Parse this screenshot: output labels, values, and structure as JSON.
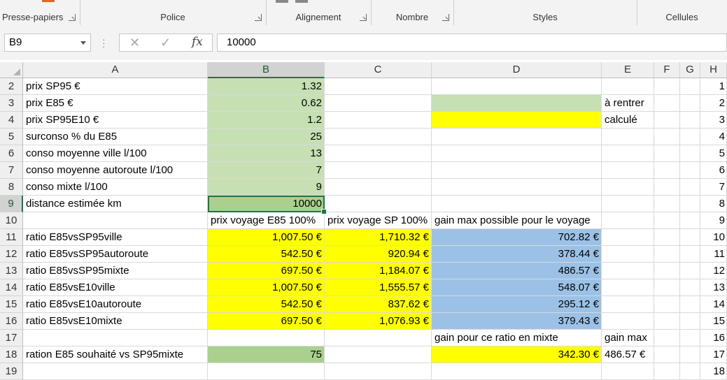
{
  "ribbon": {
    "groups": [
      {
        "label": "Presse-papiers"
      },
      {
        "label": "Police"
      },
      {
        "label": "Alignement"
      },
      {
        "label": "Nombre"
      },
      {
        "label": "Styles"
      },
      {
        "label": "Cellules"
      }
    ]
  },
  "formula_bar": {
    "name_box": "B9",
    "cancel_icon": "✕",
    "enter_icon": "✓",
    "fx_label": "fx",
    "content": "10000"
  },
  "columns": [
    "A",
    "B",
    "C",
    "D",
    "E",
    "F",
    "G",
    "H"
  ],
  "selected_column": "B",
  "selected_row": "9",
  "rows": [
    {
      "n": "2",
      "A": "prix SP95 €",
      "B": "1.32",
      "C": "",
      "D": "",
      "E": "",
      "F": "",
      "G": "",
      "H": "1"
    },
    {
      "n": "3",
      "A": "prix E85 €",
      "B": "0.62",
      "C": "",
      "D": "",
      "E": "à rentrer",
      "F": "",
      "G": "",
      "H": "2"
    },
    {
      "n": "4",
      "A": "prix SP95E10 €",
      "B": "1.2",
      "C": "",
      "D": "",
      "E": "calculé",
      "F": "",
      "G": "",
      "H": "3"
    },
    {
      "n": "5",
      "A": "surconso % du E85",
      "B": "25",
      "C": "",
      "D": "",
      "E": "",
      "F": "",
      "G": "",
      "H": "4"
    },
    {
      "n": "6",
      "A": "conso moyenne ville l/100",
      "B": "13",
      "C": "",
      "D": "",
      "E": "",
      "F": "",
      "G": "",
      "H": "5"
    },
    {
      "n": "7",
      "A": "conso moyenne autoroute l/100",
      "B": "7",
      "C": "",
      "D": "",
      "E": "",
      "F": "",
      "G": "",
      "H": "6"
    },
    {
      "n": "8",
      "A": "conso mixte l/100",
      "B": "9",
      "C": "",
      "D": "",
      "E": "",
      "F": "",
      "G": "",
      "H": "7"
    },
    {
      "n": "9",
      "A": "distance estimée km",
      "B": "10000",
      "C": "",
      "D": "",
      "E": "",
      "F": "",
      "G": "",
      "H": "8"
    },
    {
      "n": "10",
      "A": "",
      "B": "prix voyage E85 100%",
      "C": "prix voyage SP 100%",
      "D": "gain max possible pour le voyage",
      "E": "",
      "F": "",
      "G": "",
      "H": "9"
    },
    {
      "n": "11",
      "A": "ratio E85vsSP95ville",
      "B": "1,007.50 €",
      "C": "1,710.32 €",
      "D": "702.82 €",
      "E": "",
      "F": "",
      "G": "",
      "H": "10"
    },
    {
      "n": "12",
      "A": "ratio E85vsSP95autoroute",
      "B": "542.50 €",
      "C": "920.94 €",
      "D": "378.44 €",
      "E": "",
      "F": "",
      "G": "",
      "H": "11"
    },
    {
      "n": "13",
      "A": "ratio E85vsSP95mixte",
      "B": "697.50 €",
      "C": "1,184.07 €",
      "D": "486.57 €",
      "E": "",
      "F": "",
      "G": "",
      "H": "12"
    },
    {
      "n": "14",
      "A": "ratio E85vsE10ville",
      "B": "1,007.50 €",
      "C": "1,555.57 €",
      "D": "548.07 €",
      "E": "",
      "F": "",
      "G": "",
      "H": "13"
    },
    {
      "n": "15",
      "A": "ratio E85vsE10autoroute",
      "B": "542.50 €",
      "C": "837.62 €",
      "D": "295.12 €",
      "E": "",
      "F": "",
      "G": "",
      "H": "14"
    },
    {
      "n": "16",
      "A": "ratio E85vsE10mixte",
      "B": "697.50 €",
      "C": "1,076.93 €",
      "D": "379.43 €",
      "E": "",
      "F": "",
      "G": "",
      "H": "15"
    },
    {
      "n": "17",
      "A": "",
      "B": "",
      "C": "",
      "D": "gain pour ce ratio en mixte",
      "E": "gain max",
      "F": "",
      "G": "",
      "H": "16"
    },
    {
      "n": "18",
      "A": "ration E85 souhaité vs  SP95mixte",
      "B": "75",
      "C": "",
      "D": "342.30 €",
      "E": "486.57 €",
      "F": "",
      "G": "",
      "H": "17"
    },
    {
      "n": "19",
      "A": "",
      "B": "",
      "C": "",
      "D": "",
      "E": "",
      "F": "",
      "G": "",
      "H": "18"
    }
  ],
  "colors": {
    "input_green": "#c6e0b4",
    "selected_green": "#a9d08e",
    "computed_yellow": "#ffff00",
    "gain_blue": "#9bc2e6",
    "excel_green": "#217346"
  }
}
